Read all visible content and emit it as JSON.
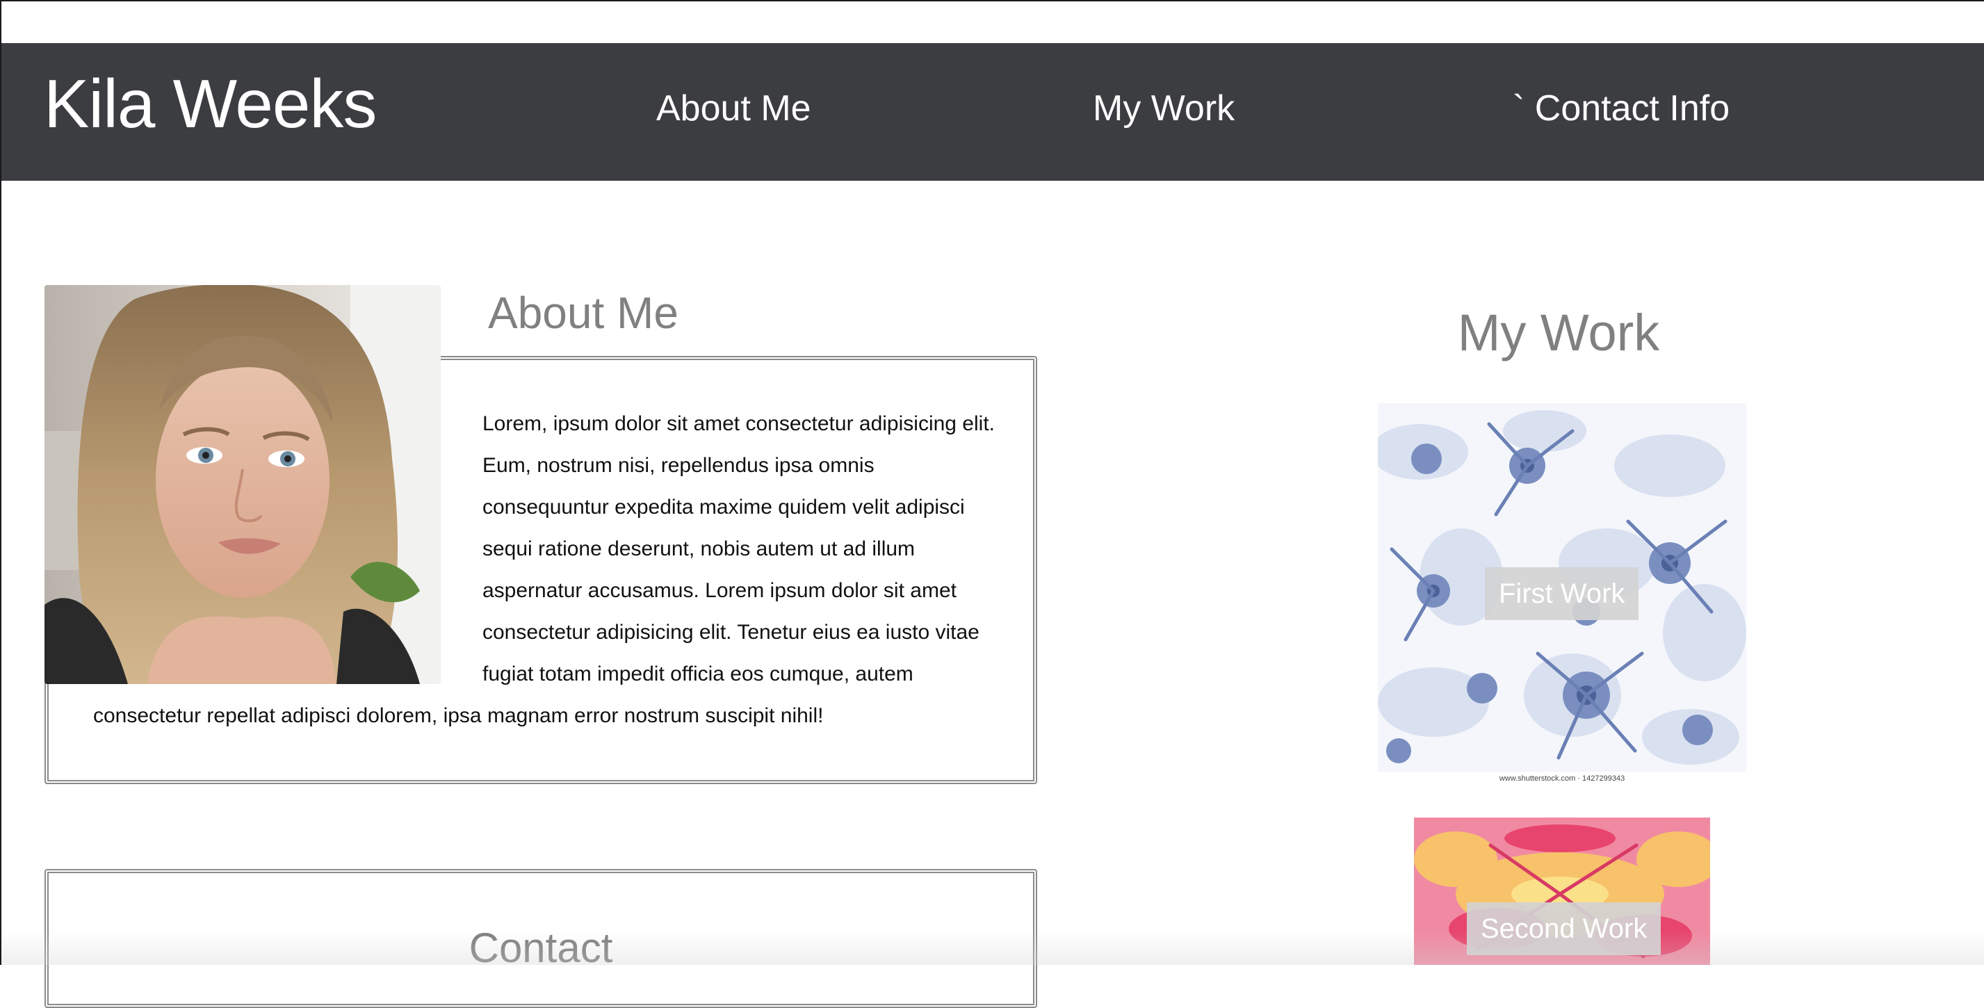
{
  "header": {
    "brand": "Kila Weeks",
    "nav": [
      {
        "label": "About Me"
      },
      {
        "label": "My Work"
      },
      {
        "label": "` Contact Info"
      }
    ]
  },
  "about": {
    "title": "About Me",
    "portrait_icon": "portrait-photo",
    "text": "Lorem, ipsum dolor sit amet consectetur adipisicing elit. Eum, nostrum nisi, repellendus ipsa omnis consequuntur expedita maxime quidem velit adipisci sequi ratione deserunt, nobis autem ut ad illum aspernatur accusamus. Lorem ipsum dolor sit amet consectetur adipisicing elit. Tenetur eius ea iusto vitae fugiat totam impedit officia eos cumque, autem consectetur repellat adipisci dolorem, ipsa magnam error nostrum suscipit nihil!"
  },
  "contact": {
    "title": "Contact"
  },
  "work": {
    "title": "My Work",
    "items": [
      {
        "label": "First Work",
        "watermark": "www.shutterstock.com · 1427299343",
        "palette": [
          "#ffffff",
          "#d9e0f0",
          "#5f78ad"
        ]
      },
      {
        "label": "Second Work",
        "palette": [
          "#f06a8c",
          "#f7b45a",
          "#e83a6a"
        ]
      }
    ]
  },
  "colors": {
    "header_bg": "#3c3d41",
    "heading_gray": "#808080",
    "border_gray": "#8a8a8a"
  }
}
